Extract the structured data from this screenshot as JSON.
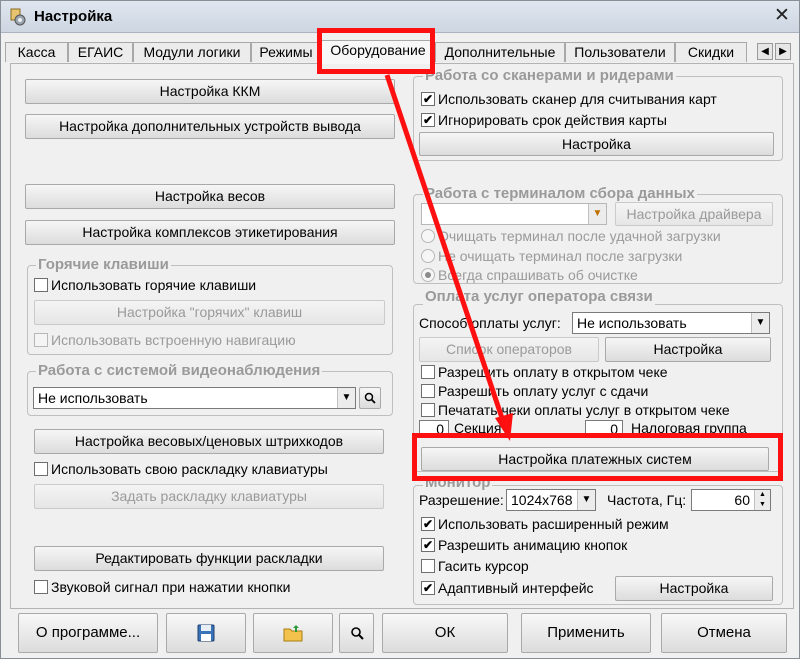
{
  "window": {
    "title": "Настройка",
    "close_glyph": "✕",
    "icon": "settings-app-icon"
  },
  "tabs": [
    "Касса",
    "ЕГАИС",
    "Модули логики",
    "Режимы",
    "Оборудование",
    "Дополнительные",
    "Пользователи",
    "Скидки"
  ],
  "tab_nav": {
    "prev": "◀",
    "next": "▶"
  },
  "active_tab": "Оборудование",
  "left": {
    "kkm_button": "Настройка ККМ",
    "output_devices_button": "Настройка дополнительных устройств вывода",
    "scales_button": "Настройка весов",
    "labeling_button": "Настройка комплексов этикетирования",
    "hotkeys": {
      "title": "Горячие клавиши",
      "use_hotkeys": "Использовать горячие клавиши",
      "hotkeys_settings": "Настройка \"горячих\" клавиш",
      "builtin_nav": "Использовать встроенную навигацию"
    },
    "video": {
      "title": "Работа с системой видеонаблюдения",
      "select_value": "Не использовать"
    },
    "barcode_button": "Настройка весовых/ценовых штрихкодов",
    "own_layout": "Использовать свою раскладку клавиатуры",
    "set_layout_button": "Задать раскладку клавиатуры",
    "edit_layout_button": "Редактировать функции раскладки",
    "beep": "Звуковой сигнал при нажатии кнопки"
  },
  "right": {
    "scanners": {
      "title": "Работа со сканерами и ридерами",
      "use_scanner": "Использовать сканер для считывания карт",
      "ignore_expiry": "Игнорировать срок действия карты",
      "settings_button": "Настройка"
    },
    "terminal": {
      "title": "Работа с терминалом сбора данных",
      "driver_button": "Настройка драйвера",
      "radio_clear": "Очищать терминал после удачной загрузки",
      "radio_keep": "Не очищать терминал после загрузки",
      "radio_ask": "Всегда спрашивать об очистке"
    },
    "operator": {
      "title": "Оплата услуг оператора связи",
      "payment_method_label": "Способ оплаты услуг:",
      "payment_method_value": "Не использовать",
      "operators_list_button": "Список операторов",
      "settings_button": "Настройка",
      "allow_open_check": "Разрешить оплату в открытом чеке",
      "allow_change": "Разрешить оплату услуг с сдачи",
      "print_checks": "Печатать чеки оплаты услуг в открытом чеке",
      "section_value": "0",
      "section_label": "Секция",
      "tax_value": "0",
      "tax_label": "Налоговая группа",
      "payment_systems_button": "Настройка платежных систем"
    },
    "monitor": {
      "title": "Монитор",
      "resolution_label": "Разрешение:",
      "resolution_value": "1024x768",
      "frequency_label": "Частота, Гц:",
      "frequency_value": "60",
      "extended_mode": "Использовать расширенный режим",
      "button_animation": "Разрешить анимацию кнопок",
      "hide_cursor": "Гасить курсор",
      "adaptive": "Адаптивный интерфейс",
      "settings_button": "Настройка"
    }
  },
  "checks": {
    "use_hotkeys": false,
    "builtin_nav": false,
    "own_layout": false,
    "beep": false,
    "use_scanner": true,
    "ignore_expiry": true,
    "allow_open_check": false,
    "allow_change": false,
    "print_checks": false,
    "extended_mode": true,
    "button_animation": true,
    "hide_cursor": false,
    "adaptive": true
  },
  "footer": {
    "about": "О программе...",
    "save_icon": "floppy-disk-icon",
    "folder_icon": "folder-upload-icon",
    "search_icon": "magnifier-icon",
    "ok": "ОК",
    "apply": "Применить",
    "cancel": "Отмена"
  },
  "colors": {
    "highlight": "#ff1010"
  }
}
